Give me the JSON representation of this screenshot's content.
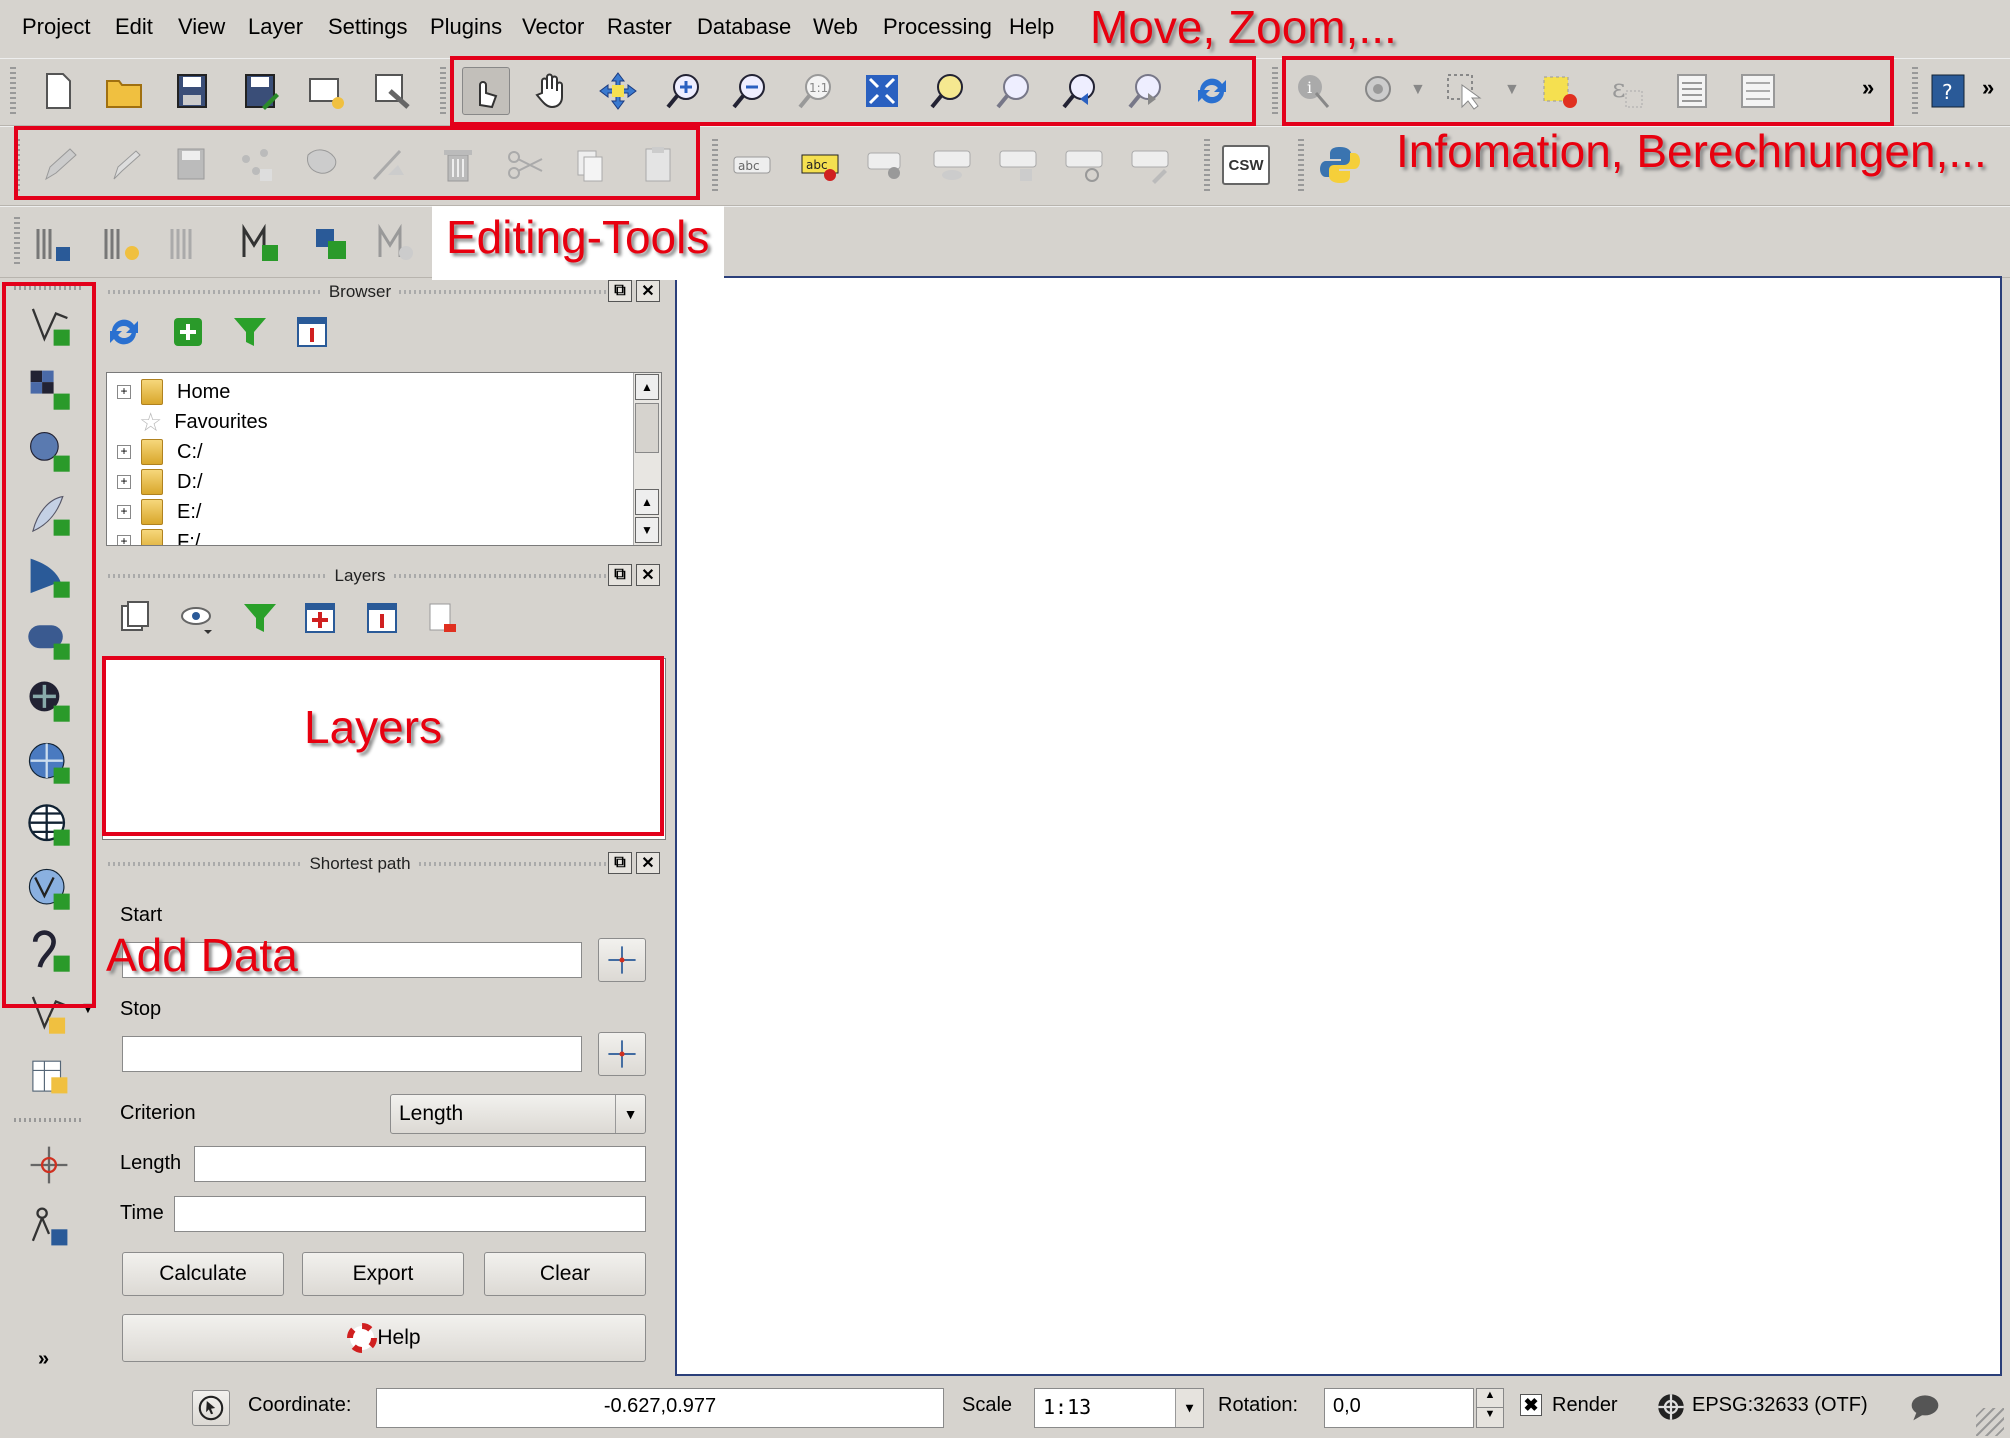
{
  "menu": [
    "Project",
    "Edit",
    "View",
    "Layer",
    "Settings",
    "Plugins",
    "Vector",
    "Raster",
    "Database",
    "Web",
    "Processing",
    "Help"
  ],
  "annotations": {
    "move_zoom": "Move, Zoom,...",
    "info": "Infomation, Berechnungen,...",
    "editing": "Editing-Tools",
    "layers": "Layers",
    "add_data": "Add Data"
  },
  "toolbar": {
    "overflow": "»",
    "csw": "CSW",
    "abc": "abc",
    "zoom_native": "1:1"
  },
  "panels": {
    "browser": "Browser",
    "layers": "Layers",
    "shortest_path": "Shortest path"
  },
  "browser_tree": [
    "Home",
    "Favourites",
    "C:/",
    "D:/",
    "E:/",
    "F:/"
  ],
  "shortest_path": {
    "start_label": "Start",
    "start_value": "",
    "stop_label": "Stop",
    "stop_value": "",
    "criterion_label": "Criterion",
    "criterion_value": "Length",
    "length_label": "Length",
    "length_value": "",
    "time_label": "Time",
    "time_value": "",
    "calculate": "Calculate",
    "export": "Export",
    "clear": "Clear",
    "help": "Help"
  },
  "statusbar": {
    "coordinate_label": "Coordinate:",
    "coordinate_value": "-0.627,0.977",
    "scale_label": "Scale",
    "scale_value": "1:13",
    "rotation_label": "Rotation:",
    "rotation_value": "0,0",
    "render_label": "Render",
    "render_checked": true,
    "crs": "EPSG:32633 (OTF)"
  },
  "colors": {
    "annotation": "#e3001b",
    "chrome": "#d6d3ce",
    "map_border": "#2b3f7a"
  }
}
